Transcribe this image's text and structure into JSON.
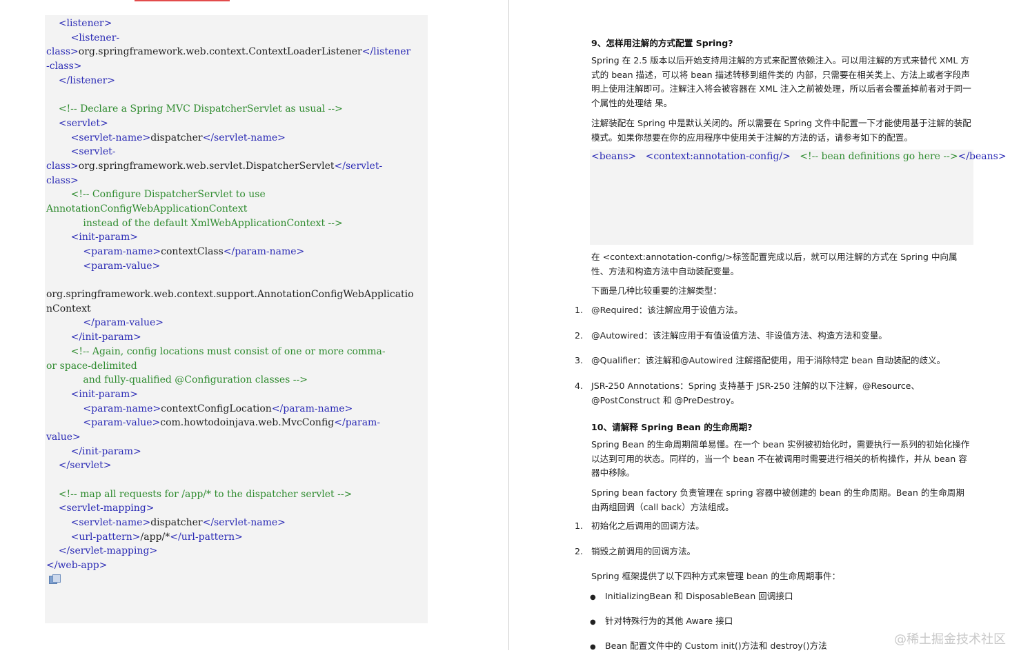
{
  "code_lines": [
    [
      [
        "",
        "    "
      ],
      [
        "t",
        "<listener>"
      ]
    ],
    [
      [
        "",
        "        "
      ],
      [
        "t",
        "<listener-"
      ]
    ],
    [
      [
        "t",
        "class>"
      ],
      [
        "",
        "org.springframework.web.context.ContextLoaderListener"
      ],
      [
        "t",
        "</listener"
      ]
    ],
    [
      [
        "t",
        "-class>"
      ]
    ],
    [
      [
        "",
        "    "
      ],
      [
        "t",
        "</listener>"
      ]
    ],
    [
      [
        "",
        ""
      ]
    ],
    [
      [
        "",
        "    "
      ],
      [
        "c",
        "<!-- Declare a Spring MVC DispatcherServlet as usual -->"
      ]
    ],
    [
      [
        "",
        "    "
      ],
      [
        "t",
        "<servlet>"
      ]
    ],
    [
      [
        "",
        "        "
      ],
      [
        "t",
        "<servlet-name>"
      ],
      [
        "",
        "dispatcher"
      ],
      [
        "t",
        "</servlet-name>"
      ]
    ],
    [
      [
        "",
        "        "
      ],
      [
        "t",
        "<servlet-"
      ]
    ],
    [
      [
        "t",
        "class>"
      ],
      [
        "",
        "org.springframework.web.servlet.DispatcherServlet"
      ],
      [
        "t",
        "</servlet-"
      ]
    ],
    [
      [
        "t",
        "class>"
      ]
    ],
    [
      [
        "",
        "        "
      ],
      [
        "c",
        "<!-- Configure DispatcherServlet to use"
      ]
    ],
    [
      [
        "c",
        "AnnotationConfigWebApplicationContext"
      ]
    ],
    [
      [
        "",
        "            "
      ],
      [
        "c",
        "instead of the default XmlWebApplicationContext -->"
      ]
    ],
    [
      [
        "",
        "        "
      ],
      [
        "t",
        "<init-param>"
      ]
    ],
    [
      [
        "",
        "            "
      ],
      [
        "t",
        "<param-name>"
      ],
      [
        "",
        "contextClass"
      ],
      [
        "t",
        "</param-name>"
      ]
    ],
    [
      [
        "",
        "            "
      ],
      [
        "t",
        "<param-value>"
      ]
    ],
    [
      [
        "",
        ""
      ]
    ],
    [
      [
        "",
        "org.springframework.web.context.support.AnnotationConfigWebApplicatio"
      ]
    ],
    [
      [
        "",
        "nContext"
      ]
    ],
    [
      [
        "",
        "            "
      ],
      [
        "t",
        "</param-value>"
      ]
    ],
    [
      [
        "",
        "        "
      ],
      [
        "t",
        "</init-param>"
      ]
    ],
    [
      [
        "",
        "        "
      ],
      [
        "c",
        "<!-- Again, config locations must consist of one or more comma-"
      ]
    ],
    [
      [
        "c",
        "or space-delimited"
      ]
    ],
    [
      [
        "",
        "            "
      ],
      [
        "c",
        "and fully-qualified @Configuration classes -->"
      ]
    ],
    [
      [
        "",
        "        "
      ],
      [
        "t",
        "<init-param>"
      ]
    ],
    [
      [
        "",
        "            "
      ],
      [
        "t",
        "<param-name>"
      ],
      [
        "",
        "contextConfigLocation"
      ],
      [
        "t",
        "</param-name>"
      ]
    ],
    [
      [
        "",
        "            "
      ],
      [
        "t",
        "<param-value>"
      ],
      [
        "",
        "com.howtodoinjava.web.MvcConfig"
      ],
      [
        "t",
        "</param-"
      ]
    ],
    [
      [
        "t",
        "value>"
      ]
    ],
    [
      [
        "",
        "        "
      ],
      [
        "t",
        "</init-param>"
      ]
    ],
    [
      [
        "",
        "    "
      ],
      [
        "t",
        "</servlet>"
      ]
    ],
    [
      [
        "",
        ""
      ]
    ],
    [
      [
        "",
        "    "
      ],
      [
        "c",
        "<!-- map all requests for /app/* to the dispatcher servlet -->"
      ]
    ],
    [
      [
        "",
        "    "
      ],
      [
        "t",
        "<servlet-mapping>"
      ]
    ],
    [
      [
        "",
        "        "
      ],
      [
        "t",
        "<servlet-name>"
      ],
      [
        "",
        "dispatcher"
      ],
      [
        "t",
        "</servlet-name>"
      ]
    ],
    [
      [
        "",
        "        "
      ],
      [
        "t",
        "<url-pattern>"
      ],
      [
        "",
        "/app/*"
      ],
      [
        "t",
        "</url-pattern>"
      ]
    ],
    [
      [
        "",
        "    "
      ],
      [
        "t",
        "</servlet-mapping>"
      ]
    ],
    [
      [
        "t",
        "</web-app>"
      ]
    ]
  ],
  "right": {
    "q9_title": "9、怎样用注解的方式配置 Spring?",
    "q9_p1_l1": "Spring 在 2.5 版本以后开始支持用注解的方式来配置依赖注入。可以用注解的方式来替代 XML 方",
    "q9_p1_l2": "式的 bean 描述，可以将 bean 描述转移到组件类的 内部，只需要在相关类上、方法上或者字段声",
    "q9_p1_l3": "明上使用注解即可。注解注入将会被容器在 XML 注入之前被处理，所以后者会覆盖掉前者对于同一",
    "q9_p1_l4": "个属性的处理结 果。",
    "q9_p2_l1": "注解装配在 Spring 中是默认关闭的。所以需要在 Spring 文件中配置一下才能使用基于注解的装配",
    "q9_p2_l2": "模式。如果你想要在你的应用程序中使用关于注解的方法的话，请参考如下的配置。",
    "snippet_lines": [
      [
        [
          "t",
          "<beans>"
        ]
      ],
      [
        [
          "",
          "   "
        ],
        [
          "t",
          "<context:annotation-config/>"
        ]
      ],
      [
        [
          "",
          "   "
        ],
        [
          "c",
          "<!-- bean definitions go here -->"
        ]
      ],
      [
        [
          "t",
          "</beans>"
        ]
      ]
    ],
    "q9_p3_l1": "在 <context:annotation-config/>标签配置完成以后，就可以用注解的方式在 Spring 中向属",
    "q9_p3_l2": "性、方法和构造方法中自动装配变量。",
    "q9_p4": "下面是几种比较重要的注解类型：",
    "annotations": [
      {
        "num": "1.",
        "text": "@Required：该注解应用于设值方法。"
      },
      {
        "num": "2.",
        "text": "@Autowired：该注解应用于有值设值方法、非设值方法、构造方法和变量。"
      },
      {
        "num": "3.",
        "text": "@Qualifier：该注解和@Autowired 注解搭配使用，用于消除特定 bean 自动装配的歧义。"
      },
      {
        "num": "4.",
        "text": "JSR-250 Annotations：Spring 支持基于 JSR-250 注解的以下注解，@Resource、"
      }
    ],
    "annotation4_cont": "@PostConstruct 和 @PreDestroy。",
    "q10_title": "10、请解释 Spring Bean 的生命周期?",
    "q10_p1_l1": "Spring Bean 的生命周期简单易懂。在一个 bean 实例被初始化时，需要执行一系列的初始化操作",
    "q10_p1_l2": "以达到可用的状态。同样的，当一个 bean 不在被调用时需要进行相关的析构操作，并从 bean 容",
    "q10_p1_l3": "器中移除。",
    "q10_p2_l1": "Spring bean factory 负责管理在 spring 容器中被创建的 bean 的生命周期。Bean 的生命周期",
    "q10_p2_l2": "由两组回调（call back）方法组成。",
    "callbacks": [
      {
        "num": "1.",
        "text": "初始化之后调用的回调方法。"
      },
      {
        "num": "2.",
        "text": "销毁之前调用的回调方法。"
      }
    ],
    "q10_p3": "Spring 框架提供了以下四种方式来管理 bean 的生命周期事件：",
    "bullets": [
      "InitializingBean 和 DisposableBean 回调接口",
      "针对特殊行为的其他 Aware 接口",
      "Bean 配置文件中的 Custom init()方法和 destroy()方法"
    ]
  },
  "watermark": "@稀土掘金技术社区"
}
